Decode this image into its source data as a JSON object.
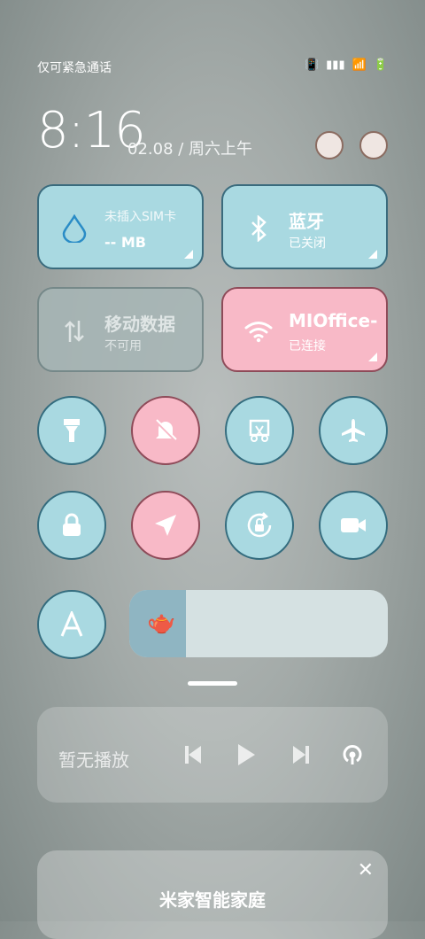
{
  "status": {
    "left_text": "仅可紧急通话"
  },
  "clock": {
    "time": "8:16",
    "date": "02.08 / 周六上午"
  },
  "tiles": [
    {
      "id": "data-usage",
      "title": "未插入SIM卡",
      "sub": "-- MB"
    },
    {
      "id": "bluetooth",
      "title": "蓝牙",
      "sub": "已关闭"
    },
    {
      "id": "mobile-data",
      "title": "移动数据",
      "sub": "不可用"
    },
    {
      "id": "wifi",
      "title": "MIOffice-",
      "sub": "已连接"
    }
  ],
  "toggles": [
    "flashlight-icon",
    "silent-icon",
    "screenshot-icon",
    "airplane-icon",
    "lock-icon",
    "location-icon",
    "rotation-lock-icon",
    "video-icon",
    "auto-brightness-icon"
  ],
  "brightness": {
    "level_percent": 22
  },
  "media": {
    "status_text": "暂无播放"
  },
  "smart_home": {
    "title": "米家智能家庭"
  },
  "colors": {
    "tile_blue": "#a9d9e1",
    "tile_pink": "#f8b9c7",
    "tile_border": "#3a6b7d"
  }
}
